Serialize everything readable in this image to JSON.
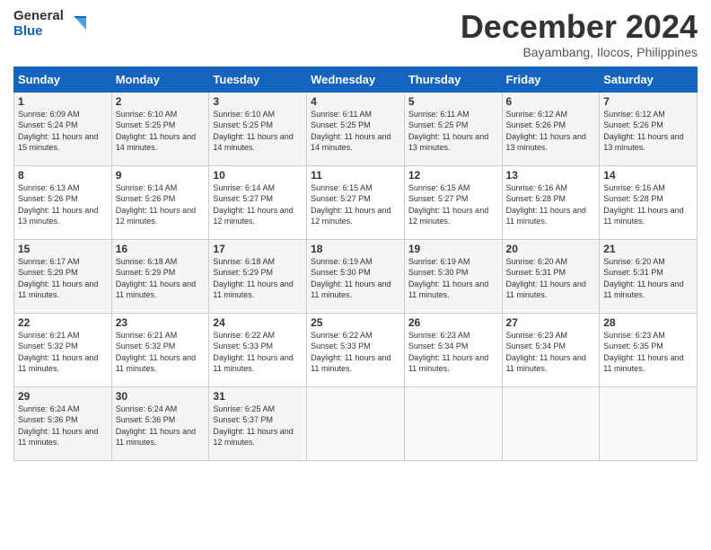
{
  "header": {
    "logo": {
      "general": "General",
      "blue": "Blue"
    },
    "title": "December 2024",
    "subtitle": "Bayambang, Ilocos, Philippines"
  },
  "calendar": {
    "days_of_week": [
      "Sunday",
      "Monday",
      "Tuesday",
      "Wednesday",
      "Thursday",
      "Friday",
      "Saturday"
    ],
    "weeks": [
      [
        {
          "day": 1,
          "sunrise": "6:09 AM",
          "sunset": "5:24 PM",
          "daylight": "11 hours and 15 minutes."
        },
        {
          "day": 2,
          "sunrise": "6:10 AM",
          "sunset": "5:25 PM",
          "daylight": "11 hours and 14 minutes."
        },
        {
          "day": 3,
          "sunrise": "6:10 AM",
          "sunset": "5:25 PM",
          "daylight": "11 hours and 14 minutes."
        },
        {
          "day": 4,
          "sunrise": "6:11 AM",
          "sunset": "5:25 PM",
          "daylight": "11 hours and 14 minutes."
        },
        {
          "day": 5,
          "sunrise": "6:11 AM",
          "sunset": "5:25 PM",
          "daylight": "11 hours and 13 minutes."
        },
        {
          "day": 6,
          "sunrise": "6:12 AM",
          "sunset": "5:26 PM",
          "daylight": "11 hours and 13 minutes."
        },
        {
          "day": 7,
          "sunrise": "6:12 AM",
          "sunset": "5:26 PM",
          "daylight": "11 hours and 13 minutes."
        }
      ],
      [
        {
          "day": 8,
          "sunrise": "6:13 AM",
          "sunset": "5:26 PM",
          "daylight": "11 hours and 13 minutes."
        },
        {
          "day": 9,
          "sunrise": "6:14 AM",
          "sunset": "5:26 PM",
          "daylight": "11 hours and 12 minutes."
        },
        {
          "day": 10,
          "sunrise": "6:14 AM",
          "sunset": "5:27 PM",
          "daylight": "11 hours and 12 minutes."
        },
        {
          "day": 11,
          "sunrise": "6:15 AM",
          "sunset": "5:27 PM",
          "daylight": "11 hours and 12 minutes."
        },
        {
          "day": 12,
          "sunrise": "6:15 AM",
          "sunset": "5:27 PM",
          "daylight": "11 hours and 12 minutes."
        },
        {
          "day": 13,
          "sunrise": "6:16 AM",
          "sunset": "5:28 PM",
          "daylight": "11 hours and 11 minutes."
        },
        {
          "day": 14,
          "sunrise": "6:16 AM",
          "sunset": "5:28 PM",
          "daylight": "11 hours and 11 minutes."
        }
      ],
      [
        {
          "day": 15,
          "sunrise": "6:17 AM",
          "sunset": "5:29 PM",
          "daylight": "11 hours and 11 minutes."
        },
        {
          "day": 16,
          "sunrise": "6:18 AM",
          "sunset": "5:29 PM",
          "daylight": "11 hours and 11 minutes."
        },
        {
          "day": 17,
          "sunrise": "6:18 AM",
          "sunset": "5:29 PM",
          "daylight": "11 hours and 11 minutes."
        },
        {
          "day": 18,
          "sunrise": "6:19 AM",
          "sunset": "5:30 PM",
          "daylight": "11 hours and 11 minutes."
        },
        {
          "day": 19,
          "sunrise": "6:19 AM",
          "sunset": "5:30 PM",
          "daylight": "11 hours and 11 minutes."
        },
        {
          "day": 20,
          "sunrise": "6:20 AM",
          "sunset": "5:31 PM",
          "daylight": "11 hours and 11 minutes."
        },
        {
          "day": 21,
          "sunrise": "6:20 AM",
          "sunset": "5:31 PM",
          "daylight": "11 hours and 11 minutes."
        }
      ],
      [
        {
          "day": 22,
          "sunrise": "6:21 AM",
          "sunset": "5:32 PM",
          "daylight": "11 hours and 11 minutes."
        },
        {
          "day": 23,
          "sunrise": "6:21 AM",
          "sunset": "5:32 PM",
          "daylight": "11 hours and 11 minutes."
        },
        {
          "day": 24,
          "sunrise": "6:22 AM",
          "sunset": "5:33 PM",
          "daylight": "11 hours and 11 minutes."
        },
        {
          "day": 25,
          "sunrise": "6:22 AM",
          "sunset": "5:33 PM",
          "daylight": "11 hours and 11 minutes."
        },
        {
          "day": 26,
          "sunrise": "6:23 AM",
          "sunset": "5:34 PM",
          "daylight": "11 hours and 11 minutes."
        },
        {
          "day": 27,
          "sunrise": "6:23 AM",
          "sunset": "5:34 PM",
          "daylight": "11 hours and 11 minutes."
        },
        {
          "day": 28,
          "sunrise": "6:23 AM",
          "sunset": "5:35 PM",
          "daylight": "11 hours and 11 minutes."
        }
      ],
      [
        {
          "day": 29,
          "sunrise": "6:24 AM",
          "sunset": "5:36 PM",
          "daylight": "11 hours and 11 minutes."
        },
        {
          "day": 30,
          "sunrise": "6:24 AM",
          "sunset": "5:36 PM",
          "daylight": "11 hours and 11 minutes."
        },
        {
          "day": 31,
          "sunrise": "6:25 AM",
          "sunset": "5:37 PM",
          "daylight": "11 hours and 12 minutes."
        },
        null,
        null,
        null,
        null
      ]
    ]
  }
}
